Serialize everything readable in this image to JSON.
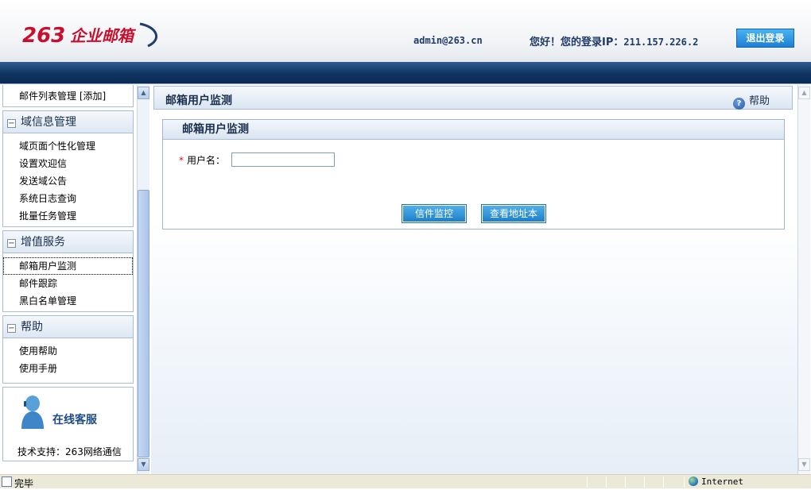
{
  "header": {
    "logo_text": "263企业邮箱",
    "user_email": "admin@263.cn",
    "greeting": "您好！您的登录IP：",
    "login_ip": "211.157.226.2",
    "logout_label": "退出登录"
  },
  "sidebar": {
    "top_items": [
      {
        "label": "邮件列表管理 [添加]"
      }
    ],
    "sections": [
      {
        "title": "域信息管理",
        "items": [
          "域页面个性化管理",
          "设置欢迎信",
          "发送域公告",
          "系统日志查询",
          "批量任务管理"
        ]
      },
      {
        "title": "增值服务",
        "items": [
          "邮箱用户监测",
          "邮件跟踪",
          "黑白名单管理"
        ],
        "selected": "邮箱用户监测"
      },
      {
        "title": "帮助",
        "items": [
          "使用帮助",
          "使用手册"
        ]
      }
    ],
    "support": {
      "label": "在线客服",
      "text": "技术支持：263网络通信"
    }
  },
  "main": {
    "page_title": "邮箱用户监测",
    "help_label": "帮助",
    "panel_title": "邮箱用户监测",
    "username_label": "用户名：",
    "username_value": "",
    "required_mark": "*",
    "buttons": {
      "monitor": "信件监控",
      "address_book": "查看地址本"
    }
  },
  "statusbar": {
    "status": "完毕",
    "zone": "Internet"
  },
  "colors": {
    "brand_red": "#c8102e",
    "nav_dark": "#0f3463",
    "button_blue": "#1e7ec8",
    "required_red": "#d01515"
  },
  "icons": {
    "logo": "263-logo",
    "customer_service": "customer-service-icon",
    "help": "question-icon",
    "globe": "globe-icon"
  }
}
